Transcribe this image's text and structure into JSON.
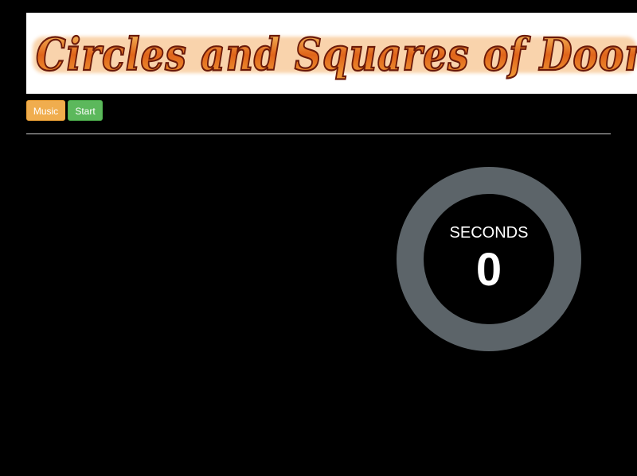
{
  "header": {
    "logo_text": "Circles and Squares of Doom"
  },
  "controls": {
    "music_label": "Music",
    "start_label": "Start"
  },
  "timer": {
    "label": "SECONDS",
    "value": "0"
  },
  "colors": {
    "music_button": "#f0ad4e",
    "start_button": "#5cb85c",
    "timer_ring": "#5c6469",
    "logo_fire": "#e0641a",
    "logo_outline": "#6b1a0a"
  }
}
